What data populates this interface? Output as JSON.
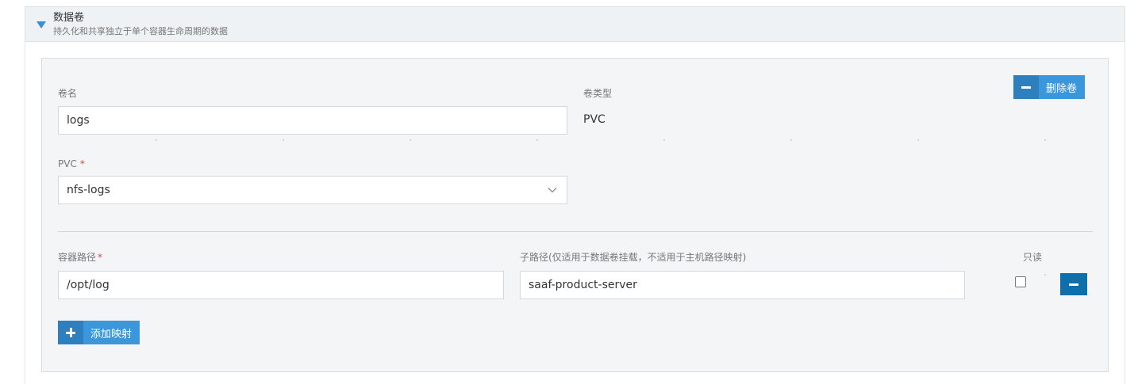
{
  "section": {
    "title": "数据卷",
    "subtitle": "持久化和共享独立于单个容器生命周期的数据"
  },
  "volume": {
    "name_label": "卷名",
    "name_value": "logs",
    "type_label": "卷类型",
    "type_value": "PVC",
    "delete_label": "删除卷",
    "pvc_label": "PVC",
    "pvc_required": "*",
    "pvc_value": "nfs-logs"
  },
  "mount": {
    "path_label": "容器路径",
    "path_required": "*",
    "path_value": "/opt/log",
    "subpath_label": "子路径(仅适用于数据卷挂载，不适用于主机路径映射)",
    "subpath_value": "saaf-product-server",
    "readonly_label": "只读",
    "readonly_checked": false,
    "add_label": "添加映射"
  },
  "icons": {
    "toggle": "caret-down-icon",
    "delete": "minus-icon",
    "remove": "minus-icon",
    "add": "plus-icon",
    "select": "chevron-down-icon"
  },
  "colors": {
    "accent": "#3b97db",
    "accent_dark": "#0f6fab",
    "required": "#e0453a"
  }
}
